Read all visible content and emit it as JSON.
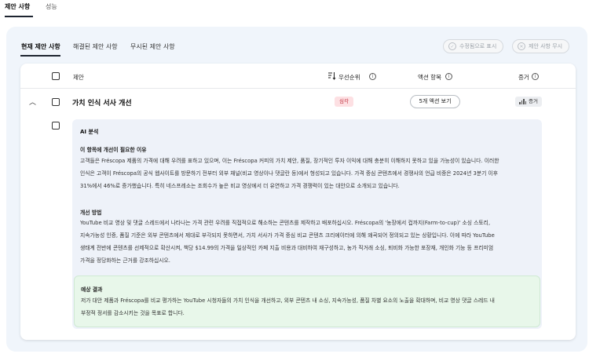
{
  "top_tabs": [
    "제안 사항",
    "성능"
  ],
  "sub_tabs": [
    "현재 제안 사항",
    "해결된 제안 사항",
    "무시된 제안 사항"
  ],
  "actions": {
    "resolve_label": "수정됨으로 표시",
    "ignore_label": "제안 사항 무시"
  },
  "table": {
    "col_suggestion": "제안",
    "col_priority": "우선순위",
    "col_actions": "액션 항목",
    "col_evidence": "증거"
  },
  "row": {
    "title": "가치 인식 서사 개선",
    "priority": "심각",
    "actions_button": "5개 액션 보기",
    "evidence": "증거"
  },
  "analysis": {
    "heading": "AI 분석",
    "why_heading": "이 항목에 개선이 필요한 이유",
    "why_lines": [
      "고객들은 Fréscopa 제품의 가격에 대해 우려를 표하고 있으며, 이는 Fréscopa 커피의 가치 제안, 품질, 장기적인 투자 이익에 대해 충분히 이해하지 못하고 있을 가능성이 있습니다. 이러한",
      "인식은 고객이 Fréscopa의 공식 웹사이트를 방문하기 전부터 외부 채널(비교 영상이나 댓글란 등)에서 형성되고 있습니다. 가격 중심 콘텐츠에서 경쟁사의 언급 비중은 2024년 3분기 이후",
      "31%에서 46%로 증가했습니다. 특히 네스프레소는 조회수가 높은 비교 영상에서 더 유연하고 가격 경쟁력이 있는 대안으로 소개되고 있습니다."
    ],
    "how_heading": "개선 방법",
    "how_lines": [
      "YouTube 비교 영상 및 댓글 스레드에서 나타나는 가격 관련 우려를 직접적으로 해소하는 콘텐츠를 제작하고 배포하십시오. Fréscopa의 '농장에서 컵까지(Farm-to-cup)' 소싱 스토리,",
      "지속가능성 인증, 품질 기준은 외부 콘텐츠에서 제대로 부각되지 못하면서, 가치 서사가 가격 중심 비교 콘텐츠 크리에이터에 의해 왜곡되어 정의되고 있는 상황입니다. 이에 따라 YouTube",
      "생태계 전반에 콘텐츠를 선제적으로 확산시켜, 책당 $14.99의 가격을 일상적인 카페 지출 비용과 대비하여 재구성하고, 농가 직거래 소싱, 퇴비화 가능한 포장재, 개인화 기능 등 프리미엄",
      "가격을 정당화하는 근거를 강조하십시오."
    ],
    "result_heading": "예상 결과",
    "result_lines": [
      "저가 대안 제품과 Fréscopa를 비교 평가하는 YouTube 시청자들의 가치 인식을 개선하고, 외부 콘텐츠 내 소싱, 지속가능성, 품질 차별 요소의 노출을 확대하며, 비교 영상 댓글 스레드 내",
      "부정적 정서를 감소시키는 것을 목표로 합니다."
    ]
  }
}
